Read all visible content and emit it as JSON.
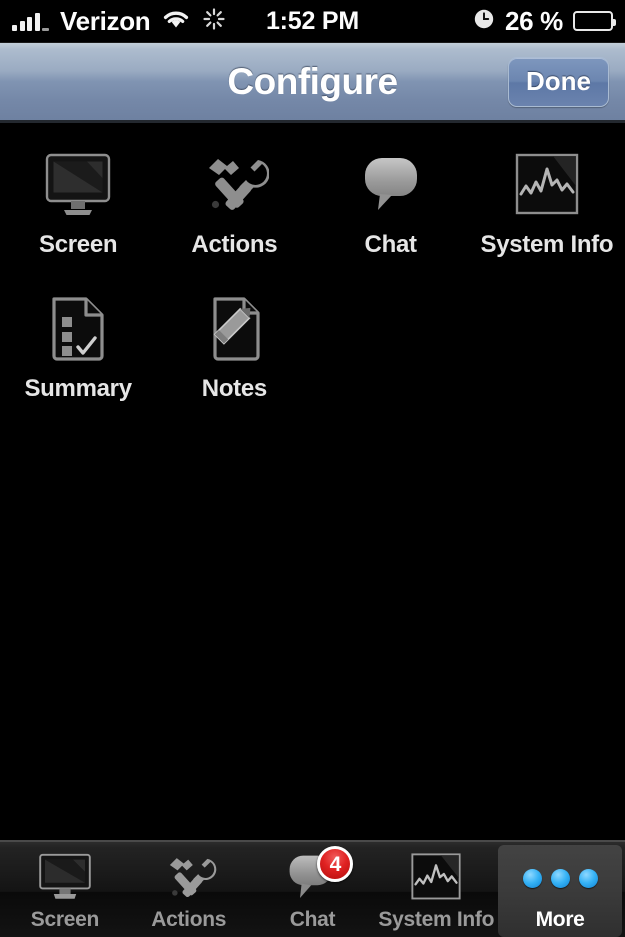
{
  "statusbar": {
    "carrier": "Verizon",
    "time": "1:52 PM",
    "battery_percent": "26 %",
    "battery_level": 26,
    "signal_icon": "signal-bars-icon",
    "wifi_icon": "wifi-icon",
    "activity_icon": "activity-spinner-icon",
    "alarm_icon": "alarm-clock-icon",
    "battery_icon": "battery-icon"
  },
  "navbar": {
    "title": "Configure",
    "done_label": "Done"
  },
  "grid": {
    "items": [
      {
        "label": "Screen",
        "icon": "monitor-icon"
      },
      {
        "label": "Actions",
        "icon": "hammer-wrench-icon"
      },
      {
        "label": "Chat",
        "icon": "speech-bubble-icon"
      },
      {
        "label": "System Info",
        "icon": "graph-square-icon"
      },
      {
        "label": "Summary",
        "icon": "document-checklist-icon"
      },
      {
        "label": "Notes",
        "icon": "document-pencil-icon"
      }
    ]
  },
  "tabbar": {
    "tabs": [
      {
        "label": "Screen",
        "icon": "monitor-icon",
        "selected": false,
        "badge": ""
      },
      {
        "label": "Actions",
        "icon": "hammer-wrench-icon",
        "selected": false,
        "badge": ""
      },
      {
        "label": "Chat",
        "icon": "speech-bubble-icon",
        "selected": false,
        "badge": "4"
      },
      {
        "label": "System Info",
        "icon": "graph-square-icon",
        "selected": false,
        "badge": ""
      },
      {
        "label": "More",
        "icon": "more-dots-icon",
        "selected": true,
        "badge": ""
      }
    ]
  },
  "colors": {
    "background": "#000000",
    "navbar_top": "#c2ced9",
    "navbar_bottom": "#6e81a1",
    "badge_red": "#e02222",
    "more_dot_blue": "#35b2f6",
    "icon_gray": "#8c8c8c",
    "label_gray": "#e6e6e6"
  }
}
